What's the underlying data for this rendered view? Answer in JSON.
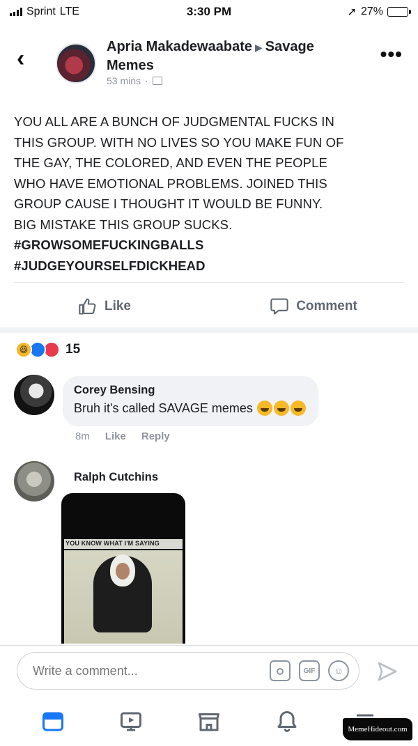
{
  "status_bar": {
    "carrier": "Sprint",
    "network": "LTE",
    "time": "3:30 PM",
    "battery_percent": "27%",
    "battery_level": 0.27
  },
  "post": {
    "author": "Apria Makadewaabate",
    "group": "Savage Memes",
    "time_ago": "53 mins",
    "body_lines": [
      "YOU ALL ARE A BUNCH OF JUDGMENTAL  FUCKS IN",
      "THIS GROUP. WITH NO LIVES SO YOU MAKE FUN OF",
      "THE GAY, THE COLORED, AND EVEN THE PEOPLE",
      "WHO HAVE EMOTIONAL PROBLEMS. JOINED THIS",
      "GROUP CAUSE I THOUGHT IT WOULD BE FUNNY.",
      "BIG MISTAKE THIS GROUP SUCKS."
    ],
    "hashtags": [
      "#GROWSOMEFUCKINGBALLS",
      "#JUDGEYOURSELFDICKHEAD"
    ]
  },
  "actions": {
    "like": "Like",
    "comment": "Comment"
  },
  "reactions": {
    "types": [
      "haha",
      "like",
      "love"
    ],
    "count": "15"
  },
  "comments": [
    {
      "name": "Corey Bensing",
      "text": "Bruh it's called SAVAGE memes",
      "time": "8m",
      "like": "Like",
      "reply": "Reply"
    },
    {
      "name": "Ralph Cutchins",
      "image_top_text": "YOU KNOW WHAT I'M SAYING"
    }
  ],
  "composer": {
    "placeholder": "Write a comment...",
    "gif_label": "GIF"
  },
  "tab_bar": {
    "items": [
      "news-feed-icon",
      "watch-icon",
      "marketplace-icon",
      "notifications-icon",
      "menu-icon"
    ]
  },
  "watermark": "MemeHideout.com",
  "colors": {
    "accent": "#1877f2",
    "bubble": "#f0f2f5",
    "muted_text": "#90949c"
  }
}
